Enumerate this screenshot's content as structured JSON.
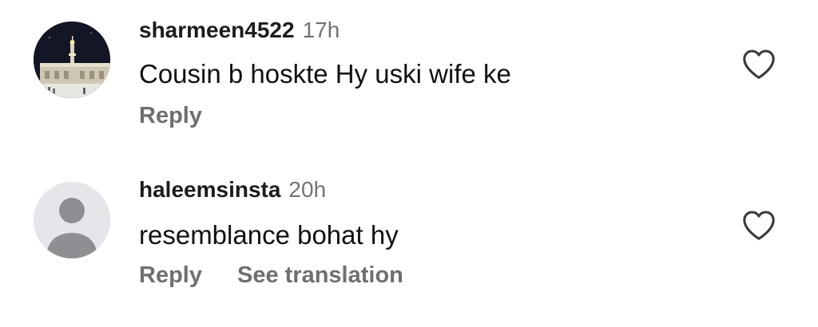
{
  "comments": [
    {
      "username": "sharmeen4522",
      "time": "17h",
      "text": "Cousin b hoskte Hy uski wife ke",
      "actions": [
        "Reply"
      ],
      "avatar": "photo",
      "like_icon": "heart-outline-icon"
    },
    {
      "username": "haleemsinsta",
      "time": "20h",
      "text": "resemblance bohat hy",
      "actions": [
        "Reply",
        "See translation"
      ],
      "avatar": "default-user-icon",
      "like_icon": "heart-outline-icon"
    }
  ],
  "colors": {
    "username": "#1c1c1c",
    "timestamp": "#737373",
    "action": "#6f6f6f",
    "default_avatar_bg": "#e4e6ea",
    "default_avatar_fg": "#8e8f93"
  }
}
